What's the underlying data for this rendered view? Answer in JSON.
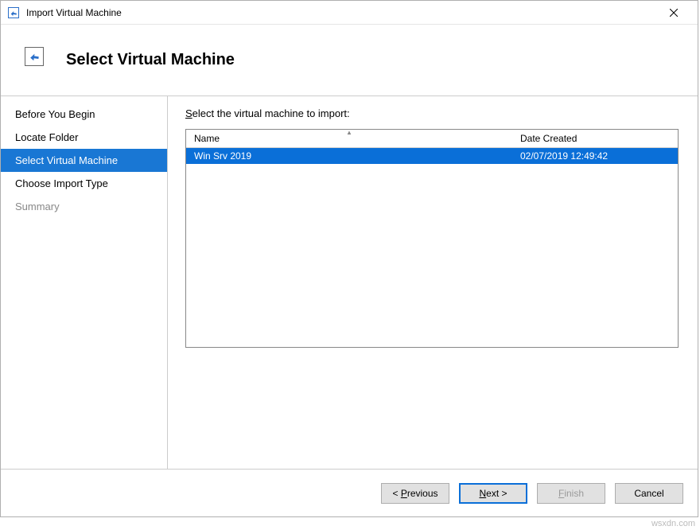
{
  "window": {
    "title": "Import Virtual Machine"
  },
  "header": {
    "title": "Select Virtual Machine"
  },
  "sidebar": {
    "items": [
      {
        "label": "Before You Begin",
        "state": "normal"
      },
      {
        "label": "Locate Folder",
        "state": "normal"
      },
      {
        "label": "Select Virtual Machine",
        "state": "selected"
      },
      {
        "label": "Choose Import Type",
        "state": "normal"
      },
      {
        "label": "Summary",
        "state": "disabled"
      }
    ]
  },
  "main": {
    "instruction_prefix": "S",
    "instruction_rest": "elect the virtual machine to import:",
    "columns": {
      "name": "Name",
      "date": "Date Created"
    },
    "rows": [
      {
        "name": "Win Srv 2019",
        "date": "02/07/2019 12:49:42",
        "selected": true
      }
    ]
  },
  "footer": {
    "previous_pre": "< ",
    "previous_u": "P",
    "previous_post": "revious",
    "next_u": "N",
    "next_post": "ext >",
    "finish_u": "F",
    "finish_post": "inish",
    "cancel": "Cancel"
  },
  "watermark": "wsxdn.com"
}
